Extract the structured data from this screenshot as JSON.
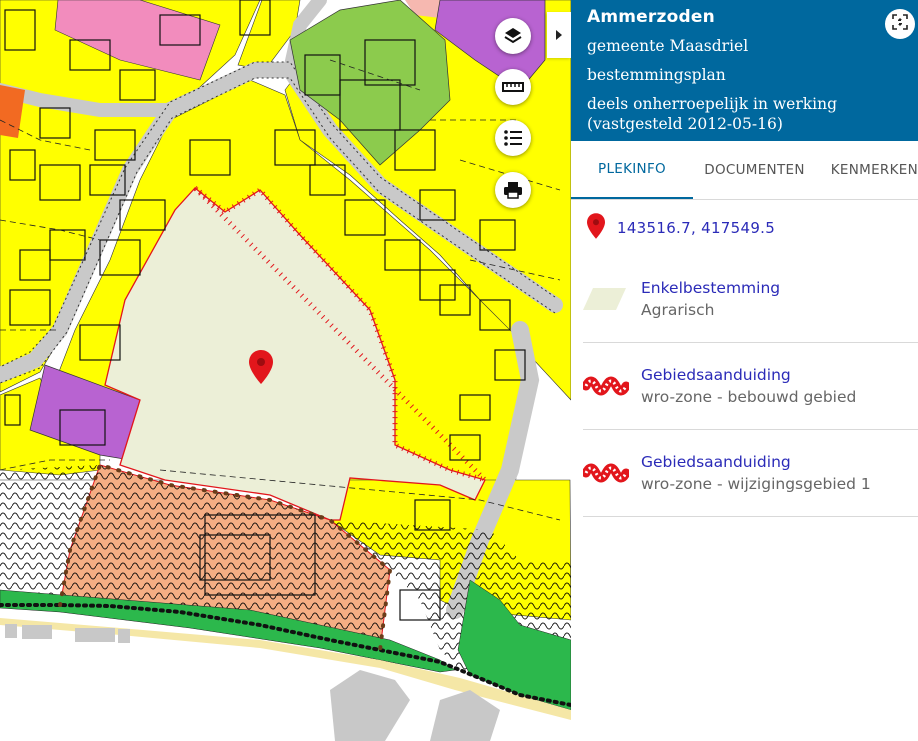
{
  "panel": {
    "title": "Ammerzoden",
    "municipality": "gemeente Maasdriel",
    "plan_type": "bestemmingsplan",
    "status": "deels onherroepelijk in werking (vastgesteld 2012-05-16)"
  },
  "tabs": [
    {
      "label": "PLEKINFO",
      "active": true
    },
    {
      "label": "DOCUMENTEN",
      "active": false
    },
    {
      "label": "KENMERKEN",
      "active": false
    }
  ],
  "location": {
    "coordinates": "143516.7, 417549.5"
  },
  "items": [
    {
      "title": "Enkelbestemming",
      "subtitle": "Agrarisch",
      "symbol": "agrarisch-swatch-icon"
    },
    {
      "title": "Gebiedsaanduiding",
      "subtitle": "wro-zone - bebouwd gebied",
      "symbol": "wro-zone-symbol-icon"
    },
    {
      "title": "Gebiedsaanduiding",
      "subtitle": "wro-zone - wijzigingsgebied 1",
      "symbol": "wro-zone-symbol-icon"
    }
  ],
  "map_controls": [
    "layers-icon",
    "ruler-icon",
    "legend-list-icon",
    "print-icon"
  ],
  "colors": {
    "header": "#00689e",
    "link": "#2b2bb8",
    "wonen": "#ffff00",
    "agrarisch": "#ecefd7",
    "bedrijf": "#b863d1",
    "groen": "#2cb84c",
    "maatschappelijk": "#8ccb4d",
    "centrum": "#f5ae84",
    "road": "#c9c9c9",
    "marker": "#e2161c"
  }
}
